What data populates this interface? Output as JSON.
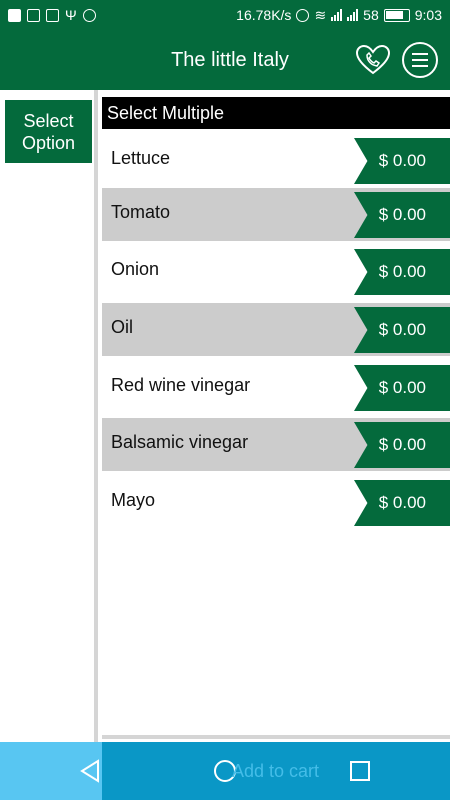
{
  "status_bar": {
    "speed": "16.78K/s",
    "battery_level": "58",
    "time": "9:03"
  },
  "header": {
    "title": "The little Italy"
  },
  "left_panel": {
    "select_option_label": "Select\nOption"
  },
  "list": {
    "header": "Select Multiple",
    "items": [
      {
        "label": "Lettuce",
        "price": "$ 0.00"
      },
      {
        "label": "Tomato",
        "price": "$ 0.00"
      },
      {
        "label": "Onion",
        "price": "$ 0.00"
      },
      {
        "label": "Oil",
        "price": "$ 0.00"
      },
      {
        "label": "Red wine vinegar",
        "price": "$ 0.00"
      },
      {
        "label": "Balsamic vinegar",
        "price": "$ 0.00"
      },
      {
        "label": "Mayo",
        "price": "$ 0.00"
      }
    ]
  },
  "footer": {
    "add_to_cart_label": "Add to cart"
  },
  "colors": {
    "brand_green": "#046a3c",
    "row_alt": "#cccccc",
    "nav_blue": "#0a97c6",
    "nav_light_blue": "#58c6f2"
  }
}
